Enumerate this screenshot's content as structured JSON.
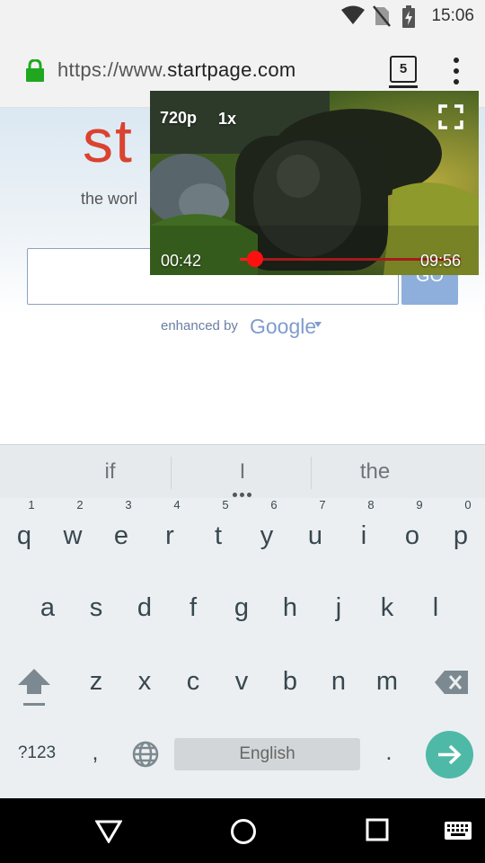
{
  "status_bar": {
    "time": "15:06",
    "icons": [
      "wifi-icon",
      "no-sim-icon",
      "battery-charging-icon"
    ]
  },
  "browser": {
    "url_scheme": "https://www.",
    "url_host": "startpage.com",
    "tab_count": "5",
    "icons": [
      "lock-icon",
      "tabs-icon",
      "overflow-menu-icon"
    ]
  },
  "page": {
    "logo_fragment": "st",
    "tagline_fragment": "the worl",
    "search_value": "",
    "go_label": "GO",
    "enhanced_by": "enhanced by",
    "google": "Google"
  },
  "video": {
    "quality": "720p",
    "speed": "1x",
    "current_time": "00:42",
    "duration": "09:56",
    "progress": 0.07,
    "icons": [
      "fullscreen-icon"
    ]
  },
  "keyboard": {
    "suggestions": [
      "if",
      "I",
      "the"
    ],
    "row1": [
      {
        "key": "q",
        "hint": "1"
      },
      {
        "key": "w",
        "hint": "2"
      },
      {
        "key": "e",
        "hint": "3"
      },
      {
        "key": "r",
        "hint": "4"
      },
      {
        "key": "t",
        "hint": "5"
      },
      {
        "key": "y",
        "hint": "6"
      },
      {
        "key": "u",
        "hint": "7"
      },
      {
        "key": "i",
        "hint": "8"
      },
      {
        "key": "o",
        "hint": "9"
      },
      {
        "key": "p",
        "hint": "0"
      }
    ],
    "row2": [
      "a",
      "s",
      "d",
      "f",
      "g",
      "h",
      "j",
      "k",
      "l"
    ],
    "row3": [
      "z",
      "x",
      "c",
      "v",
      "b",
      "n",
      "m"
    ],
    "symbols_key": "?123",
    "comma_key": ",",
    "period_key": ".",
    "space_label": "English",
    "icons": [
      "shift-icon",
      "backspace-icon",
      "globe-icon",
      "enter-arrow-icon"
    ]
  },
  "nav_bar": {
    "icons": [
      "back-icon",
      "home-icon",
      "recents-icon",
      "keyboard-switch-icon"
    ]
  },
  "colors": {
    "accent_red": "#d9432f",
    "progress_red": "#ff1c1c",
    "enter_teal": "#4fb9a8",
    "lock_green": "#1fa81f"
  }
}
